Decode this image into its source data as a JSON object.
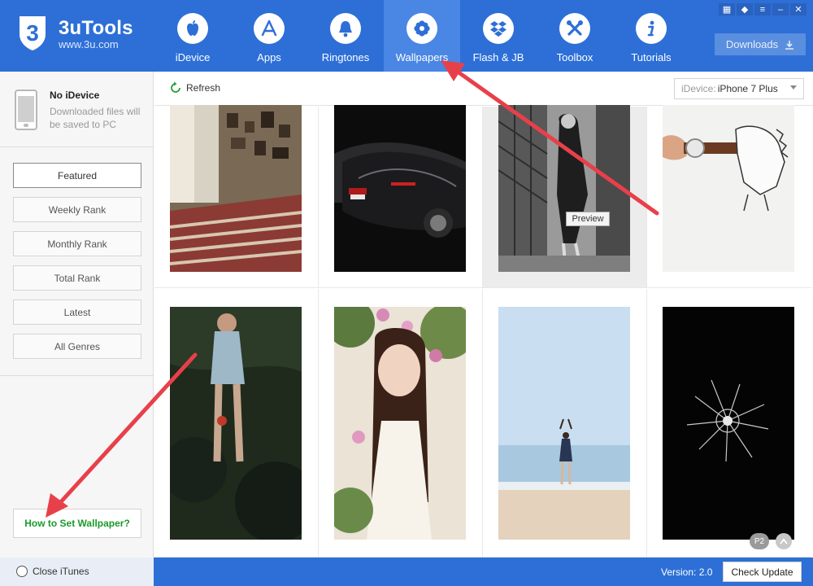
{
  "app": {
    "name": "3uTools",
    "url": "www.3u.com"
  },
  "nav": [
    {
      "label": "iDevice",
      "icon": "apple-icon"
    },
    {
      "label": "Apps",
      "icon": "app-store-icon"
    },
    {
      "label": "Ringtones",
      "icon": "bell-icon"
    },
    {
      "label": "Wallpapers",
      "icon": "flower-icon",
      "active": true
    },
    {
      "label": "Flash & JB",
      "icon": "dropbox-icon"
    },
    {
      "label": "Toolbox",
      "icon": "tools-icon"
    },
    {
      "label": "Tutorials",
      "icon": "info-icon"
    }
  ],
  "downloads_label": "Downloads",
  "device": {
    "name": "No iDevice",
    "desc": "Downloaded files will be saved to PC"
  },
  "categories": [
    "Featured",
    "Weekly Rank",
    "Monthly Rank",
    "Total Rank",
    "Latest",
    "All Genres"
  ],
  "active_category": "Featured",
  "howto_label": "How to Set Wallpaper?",
  "toolbar": {
    "refresh_label": "Refresh",
    "device_label": "iDevice:",
    "device_value": "iPhone 7 Plus"
  },
  "preview_label": "Preview",
  "page_badge": "P2",
  "bottom": {
    "close_itunes": "Close iTunes",
    "version": "Version: 2.0",
    "check_update": "Check Update"
  },
  "colors": {
    "accent": "#2d6fd7",
    "active_nav": "#4a86e3",
    "annotation_arrow": "#e8404a",
    "howto_text": "#1a9a2b"
  }
}
